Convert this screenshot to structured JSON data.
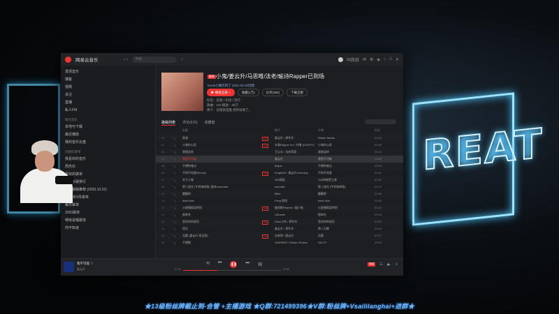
{
  "app": {
    "name": "网易云音乐",
    "search_placeholder": "搜索",
    "user_name": "叫我叔"
  },
  "sidebar": {
    "items": [
      {
        "label": "发现音乐"
      },
      {
        "label": "播客"
      },
      {
        "label": "视频"
      },
      {
        "label": "关注"
      },
      {
        "label": "直播"
      },
      {
        "label": "私人FM"
      }
    ],
    "my_music_header": "我的音乐",
    "my_items": [
      {
        "label": "本地与下载"
      },
      {
        "label": "最近播放"
      },
      {
        "label": "我的音乐云盘"
      }
    ],
    "created_header": "创建的歌单",
    "playlists": [
      {
        "label": "我喜欢的音乐"
      },
      {
        "label": "周杰伦"
      },
      {
        "label": "喜欢的歌单"
      },
      {
        "label": "我的听歌排行"
      },
      {
        "label": "每日歌曲推荐 (2020.10.22)"
      },
      {
        "label": "2020年9月歌单"
      },
      {
        "label": "每日歌单"
      },
      {
        "label": "2020歌单"
      },
      {
        "label": "嘻哈说唱歌单"
      },
      {
        "label": "你不知道"
      }
    ]
  },
  "playlist": {
    "badge": "歌单",
    "title": "小鬼/姜云升/马思唯/法老/瑜诗Rapper已到场",
    "creator": "Kevin小碗炸鸡了   2021-03-23创建",
    "buttons": {
      "play_all": "播放全部",
      "add": "+",
      "collect": "收藏(1万)",
      "share": "分享(382)",
      "download": "下载全部"
    },
    "tags": "标签：说唱 / 华语 / 流行",
    "stats": "歌曲：118   播放：38万",
    "intro": "简介：说唱就是酷 想听就来了。"
  },
  "tabs": [
    "歌曲列表",
    "评论(515)",
    "收藏者"
  ],
  "columns": {
    "title": "标题",
    "singer": "歌手",
    "album": "专辑",
    "time": "时长"
  },
  "songs": [
    {
      "idx": "01",
      "name": "离谱",
      "singer": "姜云升 / 郑冬冬",
      "album": "Winter Needs",
      "time": "03:28",
      "vip": true
    },
    {
      "idx": "02",
      "name": "小鬼的心愿",
      "singer": "木青Rapper Ku / 刘增 (GOOPY)",
      "album": "小鬼的心愿",
      "time": "03:46",
      "vip": true
    },
    {
      "idx": "03",
      "name": "我就这样",
      "singer": "王以太 / 法老哥哥",
      "album": "我就这样",
      "time": "03:12",
      "vip": false
    },
    {
      "idx": "04",
      "name": "我是不可能",
      "singer": "姜云升",
      "album": "我是不可能",
      "time": "03:58",
      "vip": false,
      "playing": true
    },
    {
      "idx": "05",
      "name": "不想你难过",
      "singer": "Mojun",
      "album": "不想你难过",
      "time": "03:05",
      "vip": false
    },
    {
      "idx": "06",
      "name": "不知不觉爱(Remix)",
      "singer": "KnightAir / 姜云升LeeKang",
      "album": "不知不觉爱",
      "time": "04:01",
      "vip": true
    },
    {
      "idx": "07",
      "name": "关于小鬼",
      "singer": "GAI周延",
      "album": "GAI的暗黑之旅",
      "time": "03:33",
      "vip": false
    },
    {
      "idx": "08",
      "name": "第三道光 (牛奶咖啡版) 喜欢xscenatix",
      "singer": "scenatix",
      "album": "第三道光 (牛奶咖啡版)",
      "time": "04:12",
      "vip": false
    },
    {
      "idx": "09",
      "name": "醒醒吧",
      "singer": "Mike",
      "album": "醒醒吧",
      "time": "02:58",
      "vip": false
    },
    {
      "idx": "10",
      "name": "back blue",
      "singer": "Feng 欧阳",
      "album": "back blue",
      "time": "03:20",
      "vip": false
    },
    {
      "idx": "11",
      "name": "火星情报局特别",
      "singer": "福克斯Rhymie / 姜小鬼",
      "album": "火星情报局特别",
      "time": "03:44",
      "vip": true
    },
    {
      "idx": "12",
      "name": "孤单芝",
      "singer": "CBunvel",
      "album": "孤单芝",
      "time": "03:15",
      "vip": false
    },
    {
      "idx": "13",
      "name": "悲伤你的说话",
      "singer": "Zhou小伙 / 郑冬冬",
      "album": "悲伤你的说话",
      "time": "03:50",
      "vip": true
    },
    {
      "idx": "14",
      "name": "再见",
      "singer": "姜云升 / 郑冬冬",
      "album": "第八天晚",
      "time": "04:05",
      "vip": false
    },
    {
      "idx": "15",
      "name": "无题 (姜云升 再见版)",
      "singer": "法老哥 / 姜云升",
      "album": "无题",
      "time": "03:37",
      "vip": true
    },
    {
      "idx": "16",
      "name": "不想脱",
      "singer": "HARRIER / Elohim Piraino",
      "album": "UN GT",
      "time": "03:09",
      "vip": false
    }
  ],
  "player": {
    "title": "我不可能",
    "artist": "姜云升",
    "current": "01:23",
    "total": "03:58",
    "progress": 0.35,
    "hq_label": "极高"
  },
  "marquee": "★13级粉丝牌截止到-合管 +主播游戏 ★Q群:721499396★V群:粉丝牌+Vsaililanghai+进群★"
}
